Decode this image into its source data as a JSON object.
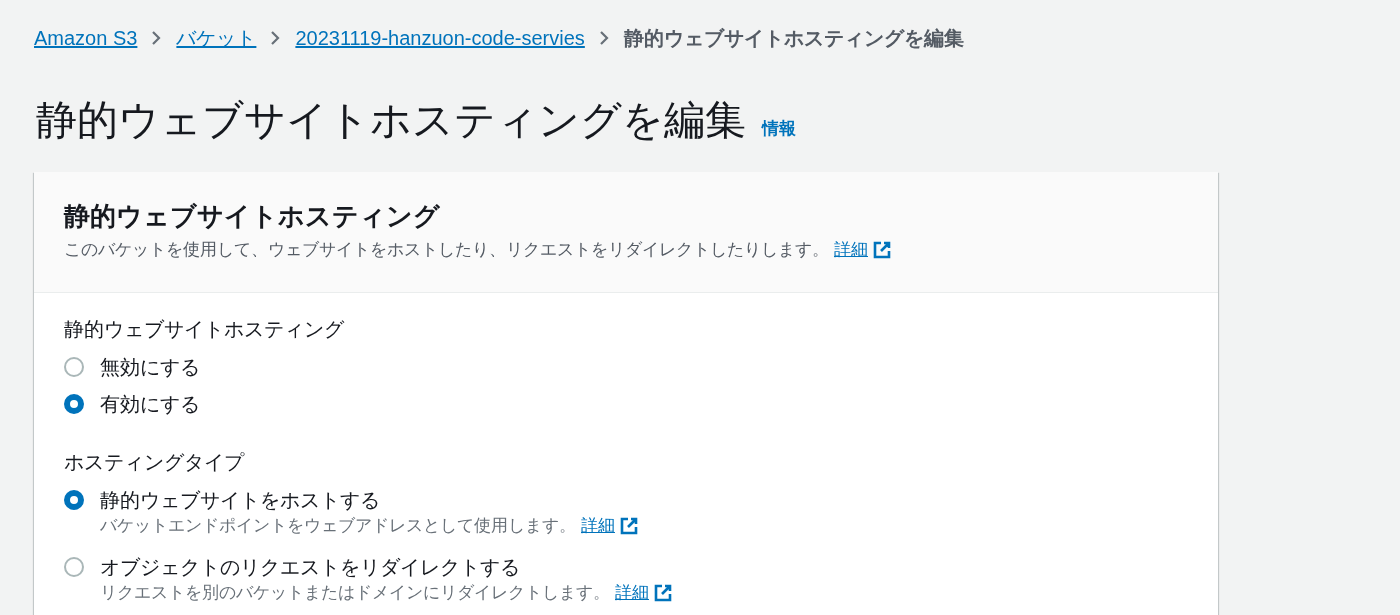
{
  "breadcrumb": [
    {
      "label": "Amazon S3",
      "kind": "link"
    },
    {
      "label": "バケット",
      "kind": "link"
    },
    {
      "label": "20231119-hanzuon-code-servies",
      "kind": "link"
    },
    {
      "label": "静的ウェブサイトホスティングを編集",
      "kind": "current"
    }
  ],
  "page": {
    "title": "静的ウェブサイトホスティングを編集",
    "info_link": "情報"
  },
  "panel": {
    "title": "静的ウェブサイトホスティング",
    "description": "このバケットを使用して、ウェブサイトをホストしたり、リクエストをリダイレクトしたりします。",
    "learn_more": "詳細"
  },
  "fields": [
    {
      "label": "静的ウェブサイトホスティング",
      "options": [
        {
          "label": "無効にする",
          "selected": false
        },
        {
          "label": "有効にする",
          "selected": true
        }
      ]
    },
    {
      "label": "ホスティングタイプ",
      "options": [
        {
          "label": "静的ウェブサイトをホストする",
          "description": "バケットエンドポイントをウェブアドレスとして使用します。",
          "learn_more": "詳細",
          "selected": true
        },
        {
          "label": "オブジェクトのリクエストをリダイレクトする",
          "description": "リクエストを別のバケットまたはドメインにリダイレクトします。",
          "learn_more": "詳細",
          "selected": false
        }
      ]
    }
  ]
}
